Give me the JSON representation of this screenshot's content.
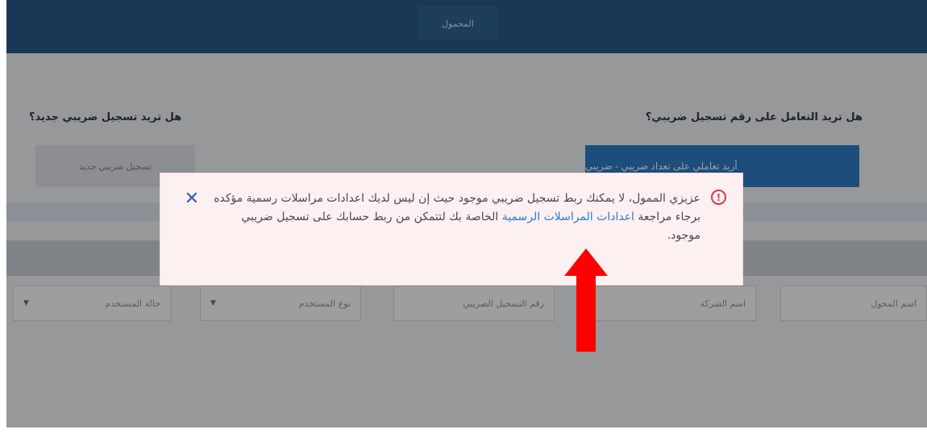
{
  "header": {
    "title": "المحمول"
  },
  "main": {
    "question_right": "هل تريد التعامل على رقم تسجيل ضريبي؟",
    "question_left": "هل تريد تسجيل ضريبي جديد؟",
    "primary_button": "أريد تعاملي على تعداد ضريبي - ضريبي",
    "secondary_button": "تسجيل ضريبي جديد",
    "filters": [
      {
        "label": "اسم المحول"
      },
      {
        "label": "اسم الشركة"
      },
      {
        "label": "رقم التسجيل الضريبي"
      },
      {
        "label": "نوع المستخدم"
      },
      {
        "label": "حالة المستخدم"
      }
    ]
  },
  "alert": {
    "line1": "عزيزي الممول، لا يمكنك ربط تسجيل ضريبي موجود حيث إن ليس لديك اعدادات مراسلات رسمية مؤكده",
    "line2_before": "برجاء مراجعة",
    "line2_link": "اعدادات المراسلات الرسمية",
    "line2_after": "الخاصة بك لتتمكن من ربط حسابك على تسجيل ضريبي موجود.",
    "close_icon": "close-icon",
    "warning_icon": "warning-icon",
    "link_color": "#2f7cc9",
    "close_color": "#2d5fa6",
    "warning_color": "#d63a48"
  },
  "annotation": {
    "arrow_color": "#ff0000"
  }
}
